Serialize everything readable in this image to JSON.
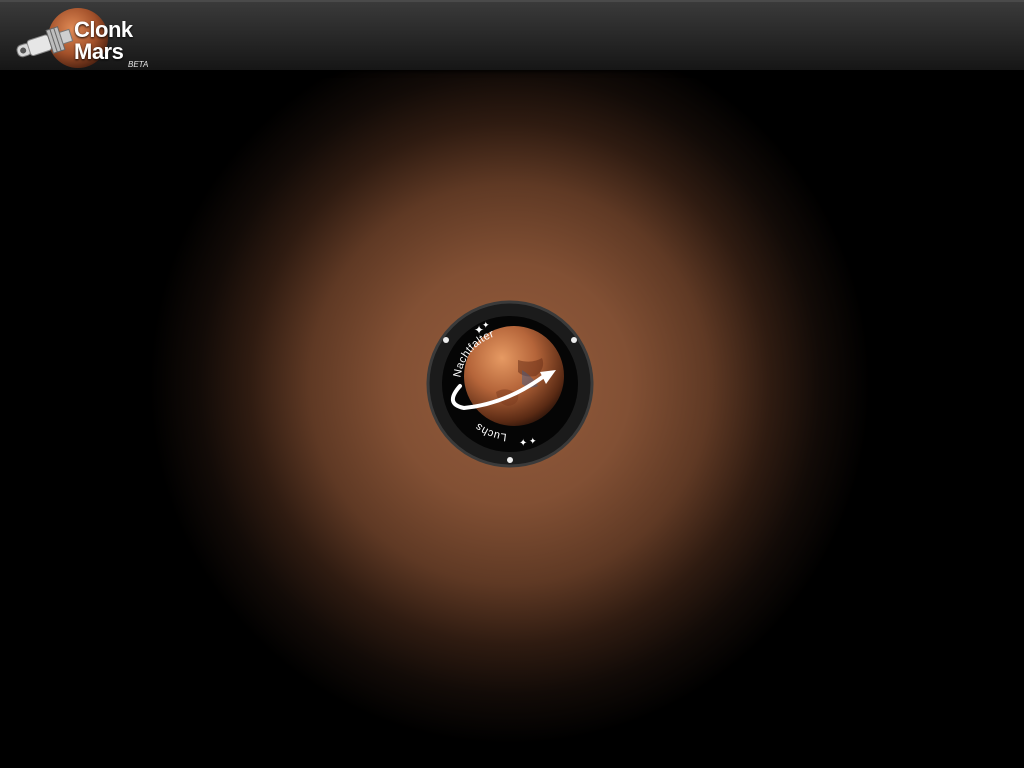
{
  "app": {
    "logo_line1": "Clonk",
    "logo_line2": "Mars",
    "logo_tag": "BETA"
  },
  "badge": {
    "top_text": "Nachtfalter",
    "bottom_text": "Luchs"
  },
  "icons": {
    "logo": "mars-spacecraft-logo-icon",
    "badge": "mars-mission-patch-icon"
  },
  "colors": {
    "background": "#000000",
    "topbar": "#2a2a2a",
    "glow": "#965c3c",
    "planet": "#b5653a"
  }
}
